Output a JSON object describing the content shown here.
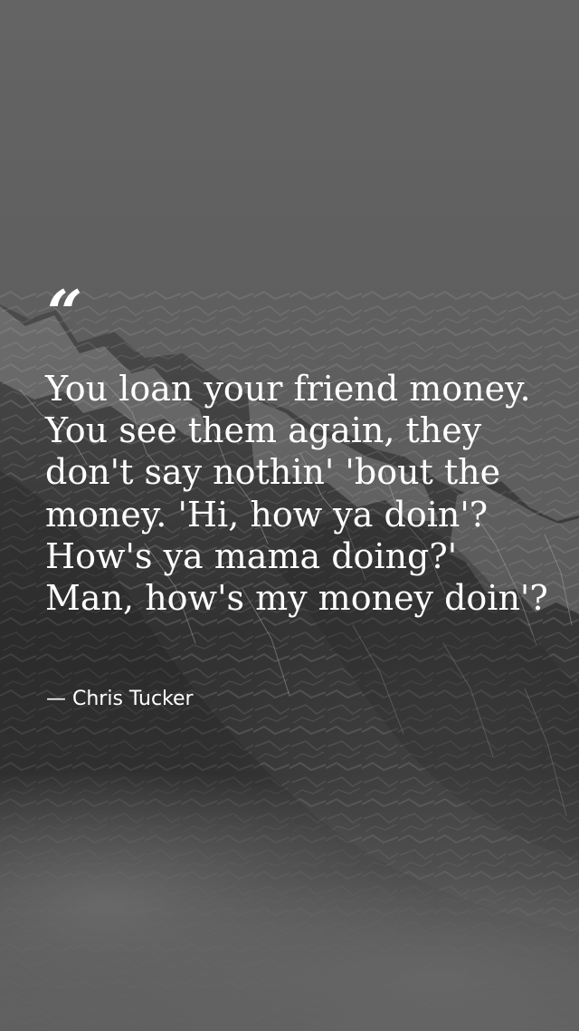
{
  "quote": {
    "mark": "“",
    "text": "You loan your friend money. You see them again, they don't say nothin' 'bout the money. 'Hi, how ya doin'? How's ya mama doing?' Man, how's my money doin'?",
    "author": "— Chris Tucker"
  },
  "background": {
    "subject": "misty snow-covered mountain",
    "sky_color": "#646464",
    "rock_color": "#2f2f2f",
    "snow_color": "#a7a7a7",
    "mist_color": "#6a6a6a"
  }
}
